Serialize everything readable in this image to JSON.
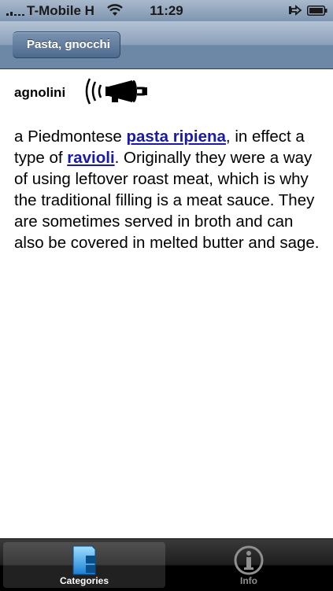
{
  "status_bar": {
    "carrier": "T-Mobile H",
    "time": "11:29"
  },
  "nav": {
    "back_label": "Pasta, gnocchi"
  },
  "entry": {
    "term": "agnolini",
    "definition": {
      "pre_link1": "a Piedmontese ",
      "link1": "pasta ripiena",
      "between": ", in effect a type of ",
      "link2": "ravioli",
      "post": ". Originally they were a way of using leftover roast meat, which is why the traditional filling is a meat sauce. They are sometimes served in broth and can also be covered in melted butter and sage."
    }
  },
  "tabs": [
    {
      "label": "Categories",
      "icon": "categories-icon",
      "active": true
    },
    {
      "label": "Info",
      "icon": "info-icon",
      "active": false
    }
  ],
  "colors": {
    "link": "#1a1aa8",
    "nav_bar": "#6d87a6",
    "tab_bar": "#000000"
  }
}
